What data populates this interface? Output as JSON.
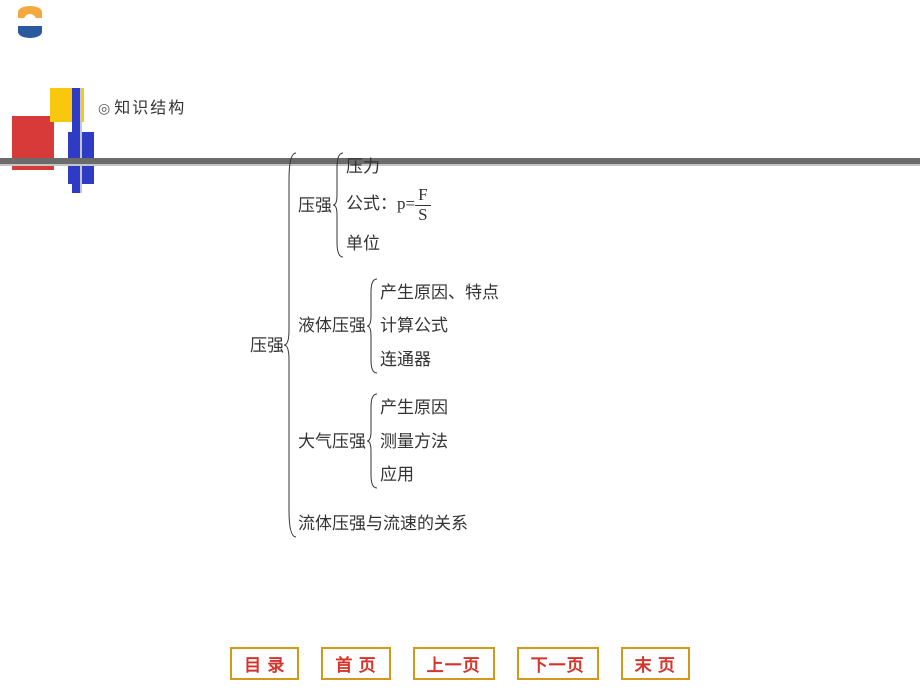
{
  "title": "知识结构",
  "root": "压强",
  "sections": [
    {
      "label": "压强",
      "items": [
        "压力",
        "公式：p=",
        "单位"
      ],
      "formula": {
        "numerator": "F",
        "denominator": "S"
      }
    },
    {
      "label": "液体压强",
      "items": [
        "产生原因、特点",
        "计算公式",
        "连通器"
      ]
    },
    {
      "label": "大气压强",
      "items": [
        "产生原因",
        "测量方法",
        "应用"
      ]
    },
    {
      "label": "流体压强与流速的关系",
      "items": []
    }
  ],
  "nav": {
    "toc": "目 录",
    "first": "首 页",
    "prev": "上一页",
    "next": "下一页",
    "last": "末 页"
  }
}
